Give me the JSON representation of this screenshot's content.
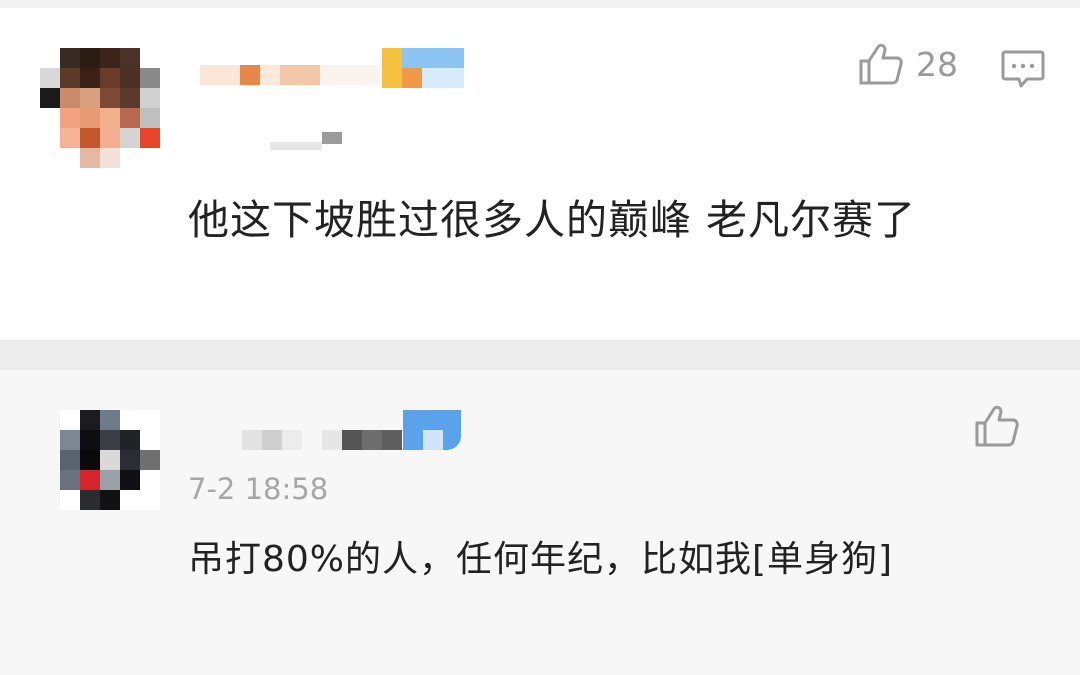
{
  "comments": [
    {
      "likes": "28",
      "text": "他这下坡胜过很多人的巅峰 老凡尔赛了"
    },
    {
      "timestamp": "7-2 18:58",
      "text": "吊打80%的人，任何年纪，比如我[单身狗]"
    }
  ],
  "icons": {
    "like": "thumbs-up-icon",
    "reply": "comment-bubble-icon"
  },
  "colors": {
    "text": "#222222",
    "meta": "#a6a6a6",
    "separator": "#ececec",
    "reply_background": "#f7f7f7"
  }
}
